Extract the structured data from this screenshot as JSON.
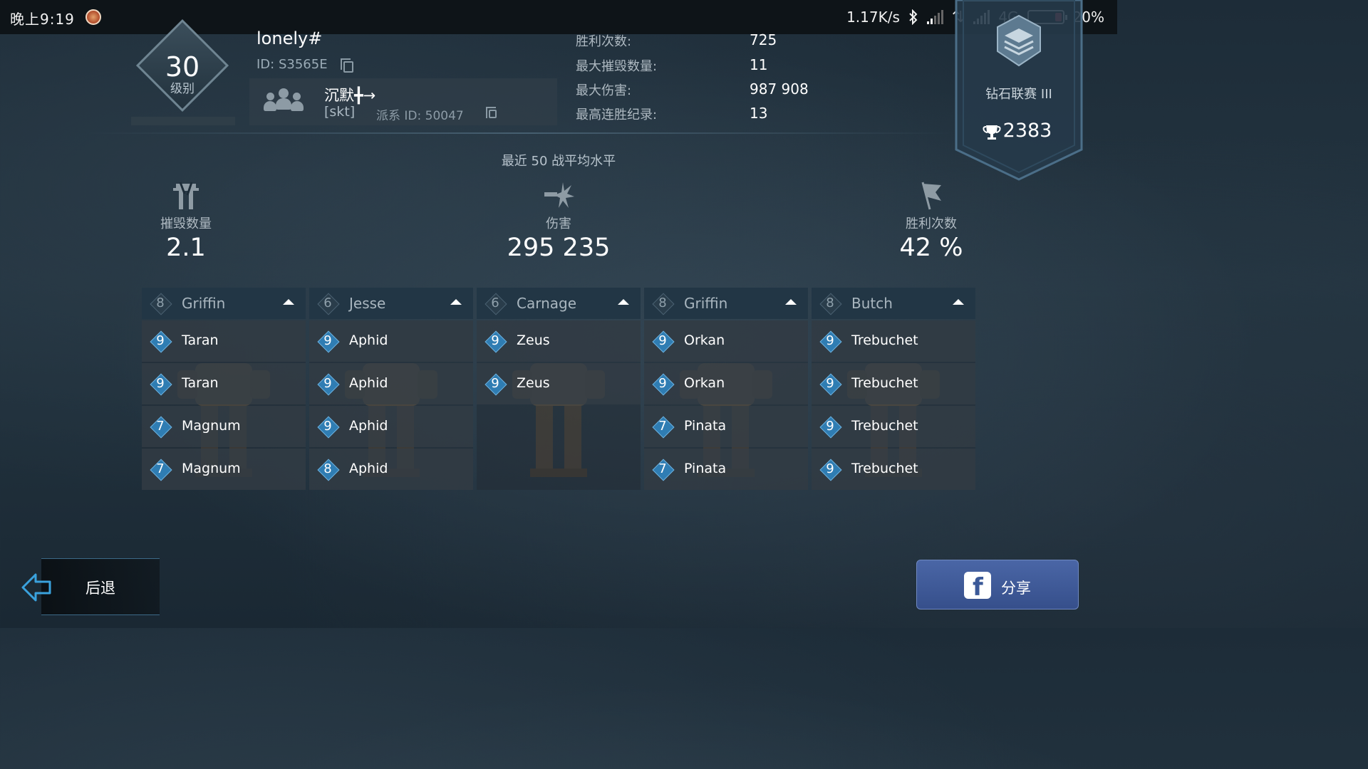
{
  "status_bar": {
    "time": "晚上9:19",
    "network_speed": "1.17K/s",
    "network_type": "4G",
    "battery": "20%",
    "battery_level": 0.2
  },
  "profile": {
    "level": "30",
    "level_label": "级别",
    "name": "lonely#",
    "id": "ID: S3565E",
    "clan": {
      "name": "沉默╋→",
      "tag": "[skt]",
      "id": "派系 ID:  50047"
    }
  },
  "stats": [
    {
      "label": "胜利次数:",
      "value": "725"
    },
    {
      "label": "最大摧毁数量:",
      "value": "11"
    },
    {
      "label": "最大伤害:",
      "value": "987 908"
    },
    {
      "label": "最高连胜纪录:",
      "value": "13"
    }
  ],
  "league": {
    "name": "钻石联赛 III",
    "score": "2383"
  },
  "averages": {
    "title": "最近 50 战平均水平",
    "kills": {
      "label": "摧毁数量",
      "value": "2.1"
    },
    "damage": {
      "label": "伤害",
      "value": "295 235"
    },
    "wins": {
      "label": "胜利次数",
      "value": "42 %"
    }
  },
  "hangars": [
    {
      "robot": "Griffin",
      "robot_level": "8",
      "weapons": [
        {
          "level": "9",
          "name": "Taran"
        },
        {
          "level": "9",
          "name": "Taran"
        },
        {
          "level": "7",
          "name": "Magnum"
        },
        {
          "level": "7",
          "name": "Magnum"
        }
      ]
    },
    {
      "robot": "Jesse",
      "robot_level": "6",
      "weapons": [
        {
          "level": "9",
          "name": "Aphid"
        },
        {
          "level": "9",
          "name": "Aphid"
        },
        {
          "level": "9",
          "name": "Aphid"
        },
        {
          "level": "8",
          "name": "Aphid"
        }
      ]
    },
    {
      "robot": "Carnage",
      "robot_level": "6",
      "weapons": [
        {
          "level": "9",
          "name": "Zeus"
        },
        {
          "level": "9",
          "name": "Zeus"
        }
      ]
    },
    {
      "robot": "Griffin",
      "robot_level": "8",
      "weapons": [
        {
          "level": "9",
          "name": "Orkan"
        },
        {
          "level": "9",
          "name": "Orkan"
        },
        {
          "level": "7",
          "name": "Pinata"
        },
        {
          "level": "7",
          "name": "Pinata"
        }
      ]
    },
    {
      "robot": "Butch",
      "robot_level": "8",
      "weapons": [
        {
          "level": "9",
          "name": "Trebuchet"
        },
        {
          "level": "9",
          "name": "Trebuchet"
        },
        {
          "level": "9",
          "name": "Trebuchet"
        },
        {
          "level": "9",
          "name": "Trebuchet"
        }
      ]
    }
  ],
  "buttons": {
    "back": "后退",
    "share": "分享"
  },
  "icons": {
    "bluetooth": "bluetooth-icon",
    "signal": "signal-icon",
    "trophy": "trophy-icon",
    "facebook": "facebook-icon",
    "back_arrow": "back-arrow-icon"
  },
  "colors": {
    "level_badge": "#2f7db3",
    "battery_low": "#e8455a",
    "share_button": "#4a66a6"
  }
}
